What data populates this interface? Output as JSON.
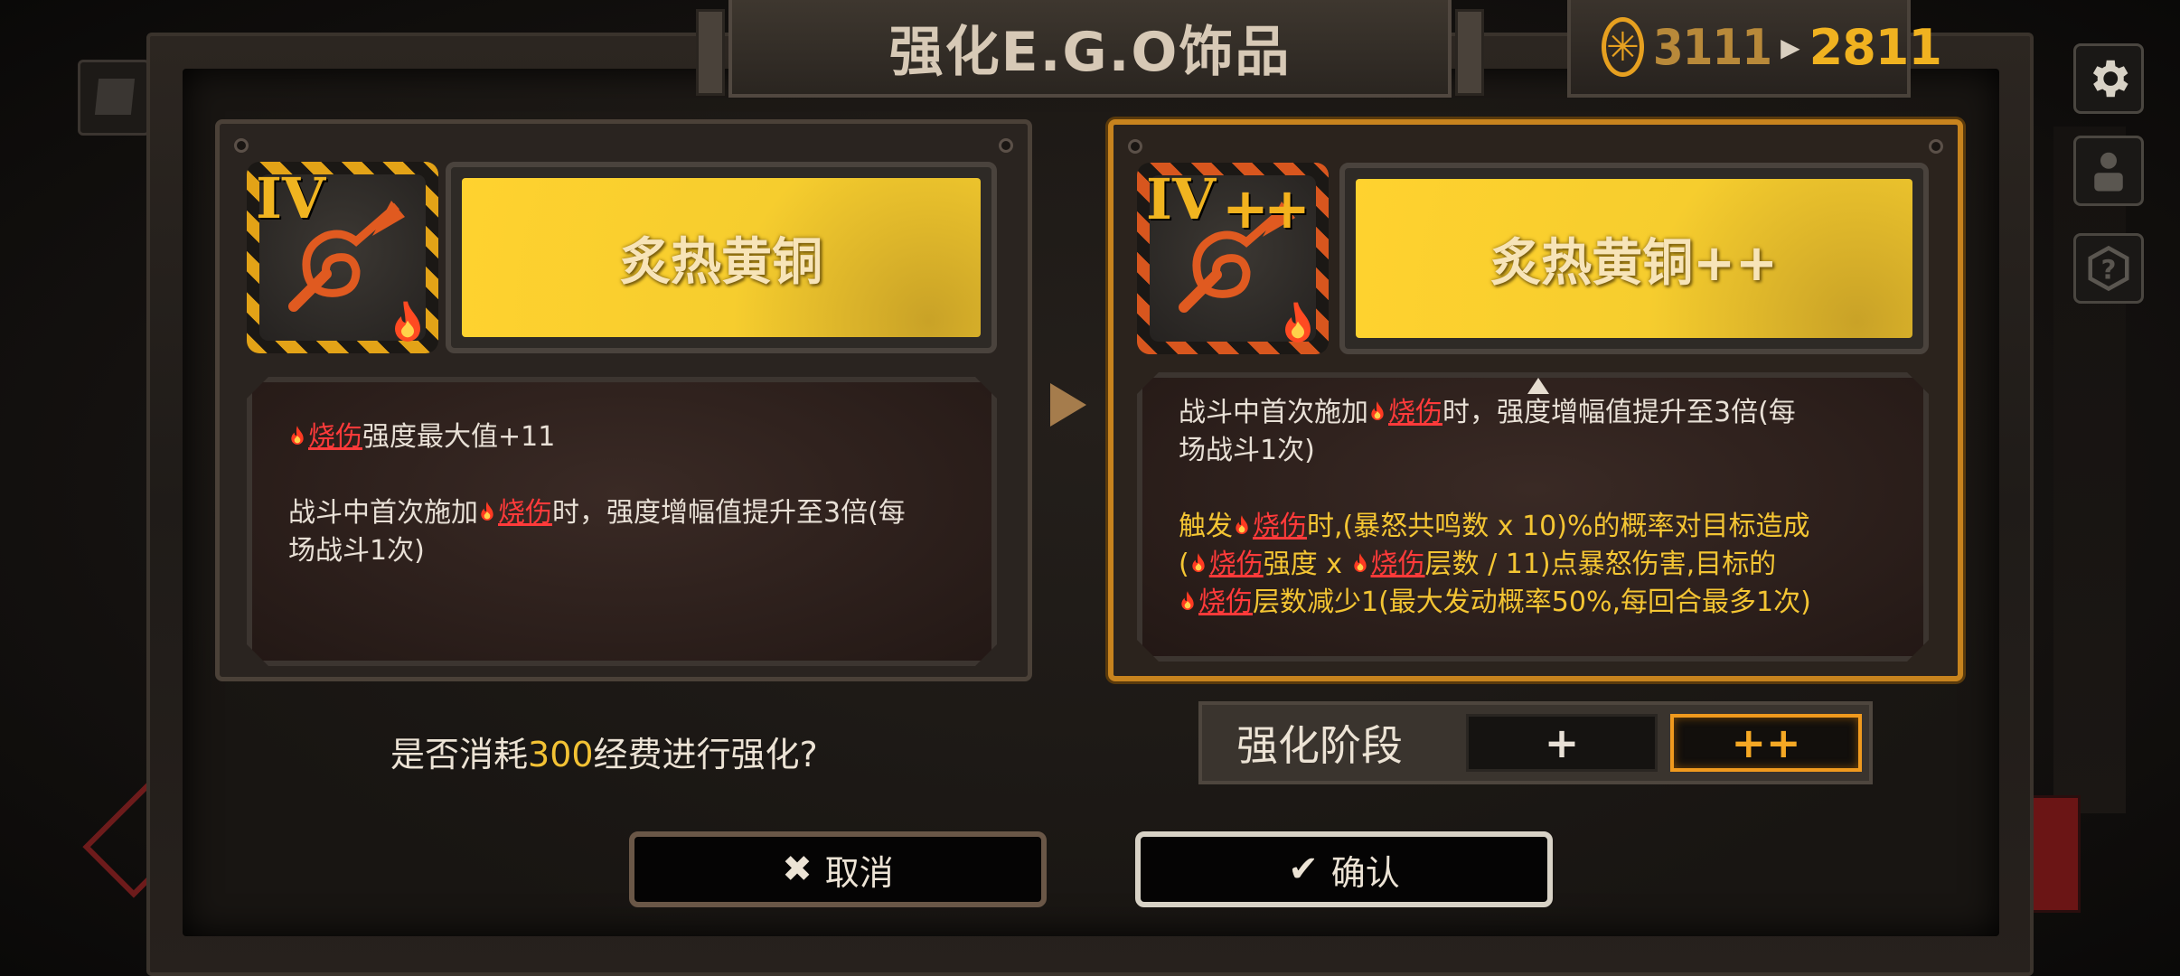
{
  "title": "强化E.G.O饰品",
  "currency": {
    "icon": "coin-icon",
    "current": "3111",
    "after": "2811",
    "color": "#f0b220"
  },
  "left_item": {
    "tier": "IV",
    "name": "炙热黄铜",
    "icon": "horn-icon",
    "desc": [
      {
        "pre": "",
        "kw": "烧伤",
        "post": "强度最大值+11"
      },
      {
        "pre": "战斗中首次施加",
        "kw": "烧伤",
        "post": "时，强度增幅值提升至3倍(每"
      },
      {
        "pre": "场战斗1次)",
        "kw": "",
        "post": ""
      }
    ]
  },
  "right_item": {
    "tier": "IV",
    "plus_badge": "++",
    "name": "炙热黄铜++",
    "icon": "horn-icon",
    "desc_white": [
      {
        "pre": "战斗中首次施加",
        "kw": "烧伤",
        "post": "时，强度增幅值提升至3倍(每"
      },
      {
        "pre": "场战斗1次)",
        "kw": "",
        "post": ""
      }
    ],
    "desc_yellow": [
      {
        "pre": "触发",
        "kw": "烧伤",
        "post": "时,(暴怒共鸣数 x 10)%的概率对目标造成"
      },
      {
        "pre": "(",
        "kw": "烧伤",
        "post": "强度 x ",
        "kw2": "烧伤",
        "post2": "层数 / 11)点暴怒伤害,目标的"
      },
      {
        "pre": "",
        "kw": "烧伤",
        "post": "层数减少1(最大发动概率50%,每回合最多1次)"
      }
    ]
  },
  "question": {
    "pre": "是否消耗",
    "cost": "300",
    "post": "经费进行强化?"
  },
  "stage": {
    "label": "强化阶段",
    "options": [
      "+",
      "++"
    ],
    "selected": "++"
  },
  "buttons": {
    "cancel": "取消",
    "confirm": "确认"
  },
  "colors": {
    "accent": "#f0b220",
    "burn_keyword": "#ff3a3a",
    "selected_border": "#f09a1e"
  }
}
